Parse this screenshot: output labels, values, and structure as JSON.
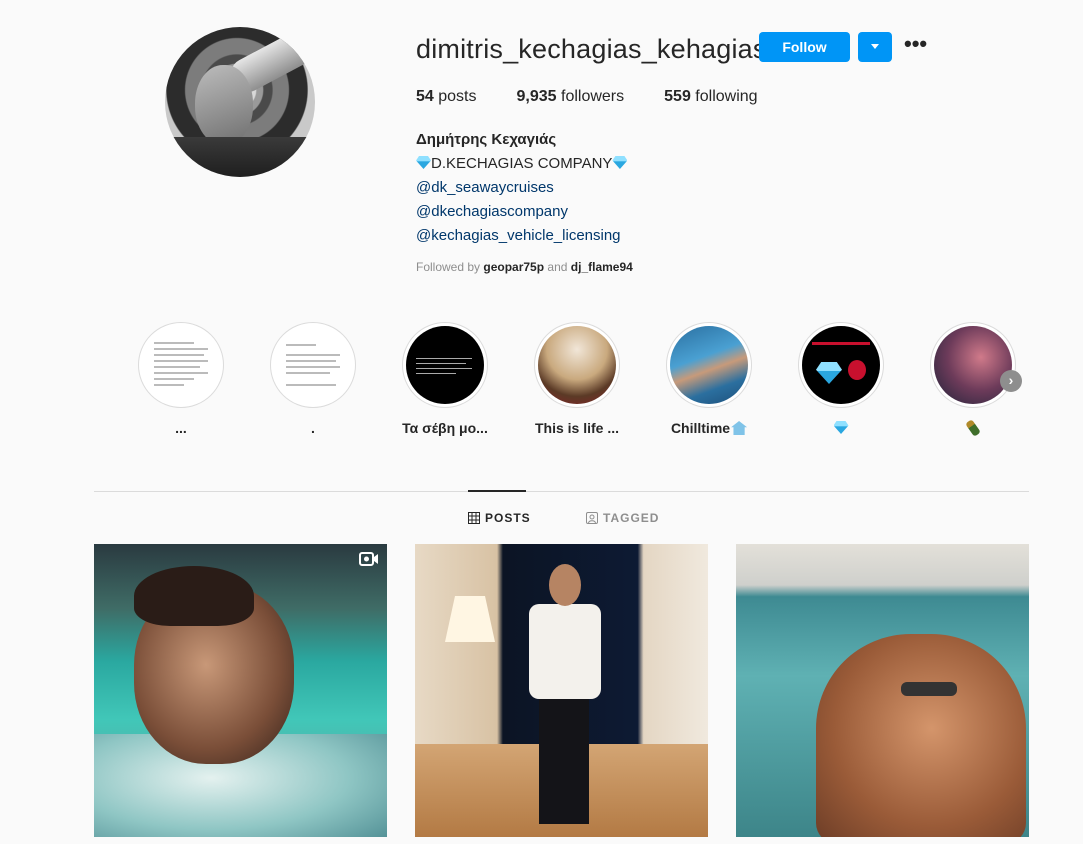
{
  "profile": {
    "username": "dimitris_kechagias_kehagias",
    "follow_label": "Follow",
    "more_label": "•••",
    "stats": {
      "posts_count": "54",
      "posts_label": "posts",
      "followers_count": "9,935",
      "followers_label": "followers",
      "following_count": "559",
      "following_label": "following"
    },
    "bio": {
      "full_name": "Δημήτρης Κεχαγιάς",
      "company_line": "D.KECHAGIAS COMPANY",
      "links": [
        "@dk_seawaycruises",
        "@dkechagiascompany",
        "@kechagias_vehicle_licensing"
      ]
    },
    "followed_by": {
      "prefix": "Followed by",
      "user1": "geopar75p",
      "conjunction": "and",
      "user2": "dj_flame94"
    }
  },
  "highlights": [
    {
      "label": "..."
    },
    {
      "label": "."
    },
    {
      "label": "Τα σέβη μο..."
    },
    {
      "label": "This is life ..."
    },
    {
      "label": "Chilltime"
    },
    {
      "label": ""
    },
    {
      "label": ""
    }
  ],
  "tabs": {
    "posts": "POSTS",
    "tagged": "TAGGED"
  },
  "icons": {
    "dropdown": "chevron-down-icon",
    "more": "more-options-icon",
    "posts_tab": "grid-icon",
    "tagged_tab": "tag-icon",
    "next": "chevron-right-icon",
    "video": "video-icon"
  },
  "colors": {
    "accent": "#0095f6",
    "link": "#00376b",
    "muted": "#8e8e8e",
    "background": "#fafafa"
  }
}
